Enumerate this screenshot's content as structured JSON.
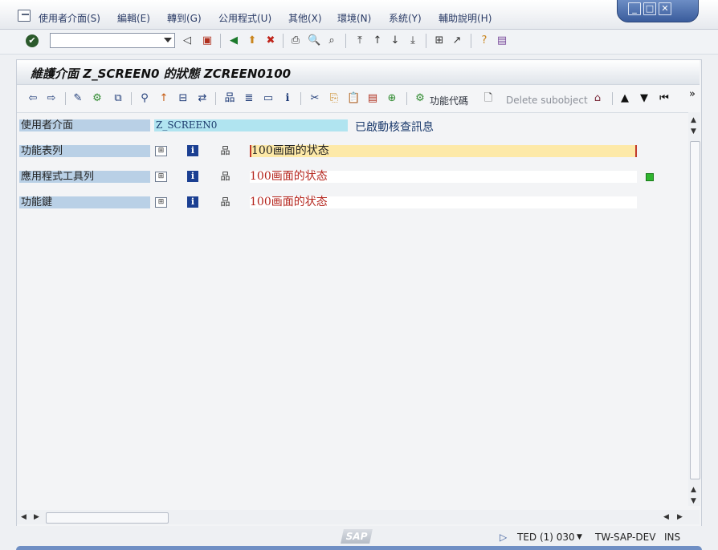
{
  "menu": {
    "items": [
      "使用者介面(S)",
      "編輯(E)",
      "轉到(G)",
      "公用程式(U)",
      "其他(X)",
      "環境(N)",
      "系統(Y)",
      "輔助說明(H)"
    ]
  },
  "window_controls": {
    "minimize": "_",
    "maximize": "□",
    "close": "✕"
  },
  "command_field": {
    "value": ""
  },
  "title": "維護介面 Z_SCREEN0 的狀態 ZCREEN0100",
  "app_toolbar": {
    "function_code_label": "功能代碼",
    "delete_subobject_label": "Delete subobject"
  },
  "rows": [
    {
      "label": "使用者介面",
      "value": "Z_SCREEN0",
      "status": "已啟動核查訊息"
    },
    {
      "label": "功能表列",
      "text": "100画面的状态"
    },
    {
      "label": "應用程式工具列",
      "text": "100画面的状态"
    },
    {
      "label": "功能鍵",
      "text": "100画面的状态"
    }
  ],
  "status_bar": {
    "logo": "SAP",
    "session": "TED (1) 030",
    "server": "TW-SAP-DEV",
    "mode": "INS"
  },
  "colors": {
    "label_bg": "#b9d0e6",
    "value_bg": "#b0e4f0",
    "active_field_bg": "#fde9a8",
    "text_red": "#b5261e",
    "status_green": "#2fb52f"
  }
}
